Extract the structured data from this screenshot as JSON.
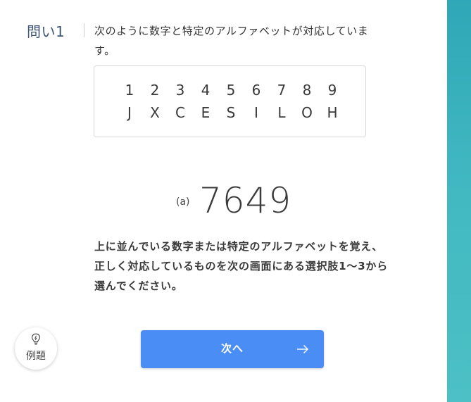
{
  "question": {
    "label": "問い1",
    "text": "次のように数字と特定のアルファベットが対応しています。"
  },
  "mapping": {
    "numbers": [
      "1",
      "2",
      "3",
      "4",
      "5",
      "6",
      "7",
      "8",
      "9"
    ],
    "letters": [
      "J",
      "X",
      "C",
      "E",
      "S",
      "I",
      "L",
      "O",
      "H"
    ]
  },
  "stimulus": {
    "label": "(a)",
    "value": "7649"
  },
  "instruction": "上に並んでいる数字または特定のアルファベットを覚え、正しく対応しているものを次の画面にある選択肢1〜3から選んでください。",
  "example_button": {
    "label": "例題",
    "icon": "lightbulb-icon"
  },
  "next_button": {
    "label": "次へ",
    "icon": "arrow-right-icon"
  },
  "colors": {
    "accent_blue": "#4a8ef5",
    "side_bar_teal": "#41b8c1",
    "question_label": "#3d5576"
  }
}
